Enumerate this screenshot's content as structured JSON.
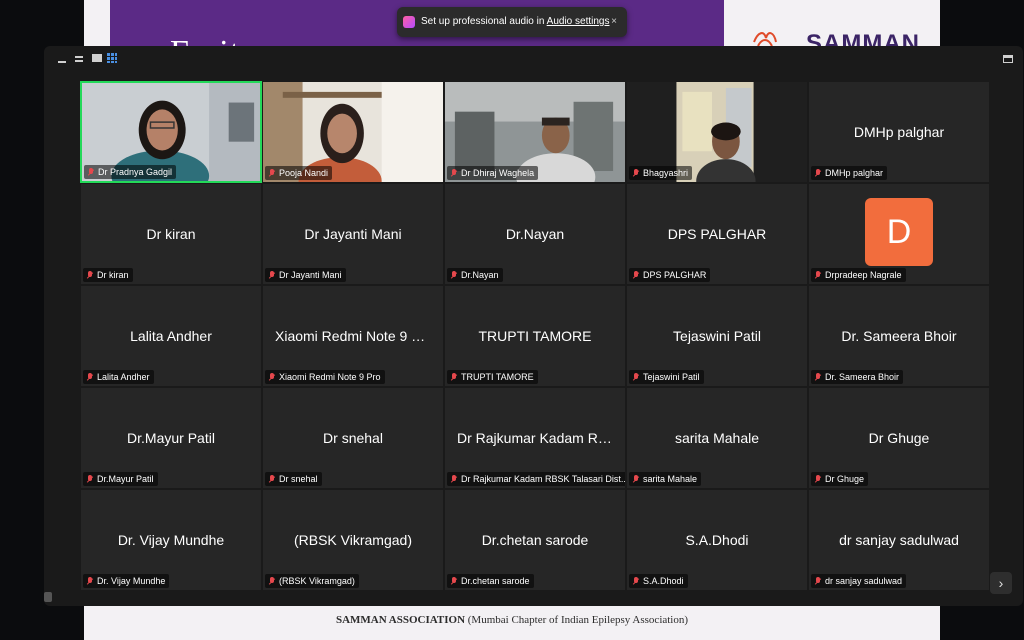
{
  "slide": {
    "heading": "Ex      it         o  ",
    "brand": "SAMMAN",
    "footer_bold": "SAMMAN ASSOCIATION",
    "footer_rest": " (Mumbai Chapter of Indian Epilepsy Association)",
    "band_color": "#5b2a86"
  },
  "toast": {
    "text": "Set up professional audio in ",
    "link": "Audio settings",
    "close": "×"
  },
  "toolbar": {
    "minimize_icon": "minimize-icon",
    "fullscreen_icon": "speaker-view-icon",
    "side_icon": "side-by-side-icon",
    "gallery_icon": "gallery-view-icon",
    "exit_icon": "exit-fullscreen-icon"
  },
  "next_page": "›",
  "participants": [
    {
      "label": "Dr Pradnya Gadgil",
      "display": "",
      "video": "speaker",
      "active": true
    },
    {
      "label": "Pooja Nandi",
      "display": "",
      "video": "woman-shelf"
    },
    {
      "label": "Dr Dhiraj Waghela",
      "display": "",
      "video": "man-office"
    },
    {
      "label": "Bhagyashri",
      "display": "",
      "video": "woman-board"
    },
    {
      "label": "DMHp palghar",
      "display": "DMHp palghar"
    },
    {
      "label": "Dr kiran",
      "display": "Dr kiran"
    },
    {
      "label": "Dr Jayanti Mani",
      "display": "Dr Jayanti Mani"
    },
    {
      "label": "Dr.Nayan",
      "display": "Dr.Nayan"
    },
    {
      "label": "DPS PALGHAR",
      "display": "DPS PALGHAR"
    },
    {
      "label": "Drpradeep Nagrale",
      "display": "",
      "avatar": "D"
    },
    {
      "label": "Lalita Andher",
      "display": "Lalita Andher"
    },
    {
      "label": "Xiaomi Redmi Note 9 Pro",
      "display": "Xiaomi Redmi Note 9 Pro"
    },
    {
      "label": "TRUPTI TAMORE",
      "display": "TRUPTI TAMORE"
    },
    {
      "label": "Tejaswini Patil",
      "display": "Tejaswini Patil"
    },
    {
      "label": "Dr. Sameera Bhoir",
      "display": "Dr. Sameera Bhoir"
    },
    {
      "label": "Dr.Mayur Patil",
      "display": "Dr.Mayur Patil"
    },
    {
      "label": "Dr snehal",
      "display": "Dr snehal"
    },
    {
      "label": "Dr Rajkumar Kadam RBSK Talasari Dist...",
      "display": "Dr Rajkumar Kadam RBS..."
    },
    {
      "label": "sarita Mahale",
      "display": "sarita Mahale"
    },
    {
      "label": "Dr Ghuge",
      "display": "Dr Ghuge"
    },
    {
      "label": "Dr. Vijay Mundhe",
      "display": "Dr. Vijay Mundhe"
    },
    {
      "label": "(RBSK Vikramgad)",
      "display": "(RBSK Vikramgad)"
    },
    {
      "label": "Dr.chetan sarode",
      "display": "Dr.chetan sarode"
    },
    {
      "label": "S.A.Dhodi",
      "display": "S.A.Dhodi"
    },
    {
      "label": "dr sanjay sadulwad",
      "display": "dr sanjay sadulwad"
    }
  ]
}
